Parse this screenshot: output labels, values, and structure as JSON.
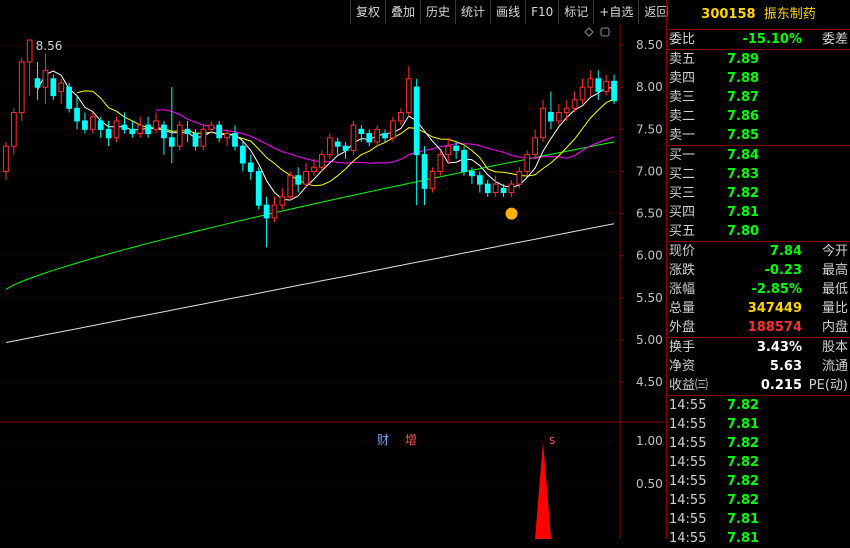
{
  "toolbar": [
    "复权",
    "叠加",
    "历史",
    "统计",
    "画线",
    "F10",
    "标记",
    "+自选",
    "返回"
  ],
  "stock": {
    "code": "300158",
    "name": "振东制药"
  },
  "weibi": {
    "label": "委比",
    "value": "-15.10%",
    "right": "委差"
  },
  "asks": [
    {
      "label": "卖五",
      "price": "7.89"
    },
    {
      "label": "卖四",
      "price": "7.88"
    },
    {
      "label": "卖三",
      "price": "7.87"
    },
    {
      "label": "卖二",
      "price": "7.86"
    },
    {
      "label": "卖一",
      "price": "7.85"
    }
  ],
  "bids": [
    {
      "label": "买一",
      "price": "7.84"
    },
    {
      "label": "买二",
      "price": "7.83"
    },
    {
      "label": "买三",
      "price": "7.82"
    },
    {
      "label": "买四",
      "price": "7.81"
    },
    {
      "label": "买五",
      "price": "7.80"
    }
  ],
  "stats1": [
    {
      "label": "现价",
      "value": "7.84",
      "right": "今开",
      "cls": "green"
    },
    {
      "label": "涨跌",
      "value": "-0.23",
      "right": "最高",
      "cls": "green"
    },
    {
      "label": "涨幅",
      "value": "-2.85%",
      "right": "最低",
      "cls": "green"
    },
    {
      "label": "总量",
      "value": "347449",
      "right": "量比",
      "cls": "yel"
    },
    {
      "label": "外盘",
      "value": "188574",
      "right": "内盘",
      "cls": "red"
    }
  ],
  "stats2": [
    {
      "label": "换手",
      "value": "3.43%",
      "right": "股本",
      "cls": "white"
    },
    {
      "label": "净资",
      "value": "5.63",
      "right": "流通",
      "cls": "white"
    },
    {
      "label": "收益㈢",
      "value": "0.215",
      "right": "PE(动)",
      "cls": "white"
    }
  ],
  "ticks": [
    {
      "time": "14:55",
      "price": "7.82"
    },
    {
      "time": "14:55",
      "price": "7.81"
    },
    {
      "time": "14:55",
      "price": "7.82"
    },
    {
      "time": "14:55",
      "price": "7.82"
    },
    {
      "time": "14:55",
      "price": "7.82"
    },
    {
      "time": "14:55",
      "price": "7.82"
    },
    {
      "time": "14:55",
      "price": "7.81"
    },
    {
      "time": "14:55",
      "price": "7.81"
    }
  ],
  "chart": {
    "price_axis": [
      "8.50",
      "8.00",
      "7.50",
      "7.00",
      "6.50",
      "6.00",
      "5.50",
      "5.00",
      "4.50"
    ],
    "sub_axis": [
      "1.00",
      "0.50"
    ],
    "high_label": "8.56",
    "markers": {
      "cai": "财",
      "zeng": "增",
      "s": "s"
    }
  },
  "chart_data": {
    "type": "candlestick",
    "price_range": [
      4.3,
      8.75
    ],
    "candles": [
      [
        7.0,
        7.3,
        6.9,
        7.35
      ],
      [
        7.3,
        7.7,
        7.2,
        7.75
      ],
      [
        7.7,
        8.3,
        7.6,
        8.35
      ],
      [
        8.3,
        8.56,
        7.9,
        8.56
      ],
      [
        8.1,
        8.0,
        7.85,
        8.3
      ],
      [
        8.0,
        8.2,
        7.8,
        8.4
      ],
      [
        8.1,
        7.9,
        7.85,
        8.15
      ],
      [
        7.95,
        8.05,
        7.8,
        8.1
      ],
      [
        8.0,
        7.75,
        7.7,
        8.05
      ],
      [
        7.75,
        7.6,
        7.5,
        7.9
      ],
      [
        7.6,
        7.5,
        7.45,
        7.7
      ],
      [
        7.5,
        7.65,
        7.45,
        7.7
      ],
      [
        7.6,
        7.5,
        7.4,
        7.65
      ],
      [
        7.5,
        7.4,
        7.3,
        7.6
      ],
      [
        7.4,
        7.6,
        7.35,
        7.65
      ],
      [
        7.55,
        7.5,
        7.45,
        7.7
      ],
      [
        7.5,
        7.45,
        7.4,
        7.6
      ],
      [
        7.45,
        7.55,
        7.4,
        7.65
      ],
      [
        7.55,
        7.45,
        7.4,
        7.65
      ],
      [
        7.5,
        7.6,
        7.45,
        7.7
      ],
      [
        7.55,
        7.4,
        7.2,
        7.6
      ],
      [
        7.4,
        7.3,
        7.1,
        8.0
      ],
      [
        7.3,
        7.55,
        7.25,
        7.6
      ],
      [
        7.5,
        7.45,
        7.35,
        7.6
      ],
      [
        7.45,
        7.3,
        7.25,
        7.5
      ],
      [
        7.3,
        7.5,
        7.25,
        7.55
      ],
      [
        7.5,
        7.55,
        7.45,
        7.6
      ],
      [
        7.55,
        7.4,
        7.35,
        7.6
      ],
      [
        7.4,
        7.45,
        7.3,
        7.5
      ],
      [
        7.45,
        7.3,
        7.25,
        7.55
      ],
      [
        7.3,
        7.1,
        7.0,
        7.35
      ],
      [
        7.1,
        7.0,
        6.9,
        7.2
      ],
      [
        7.0,
        6.6,
        6.55,
        7.05
      ],
      [
        6.6,
        6.45,
        6.1,
        6.7
      ],
      [
        6.45,
        6.6,
        6.4,
        6.7
      ],
      [
        6.6,
        6.7,
        6.55,
        6.8
      ],
      [
        6.7,
        6.95,
        6.65,
        7.0
      ],
      [
        6.95,
        6.85,
        6.75,
        7.05
      ],
      [
        6.85,
        7.0,
        6.8,
        7.1
      ],
      [
        7.0,
        7.05,
        6.95,
        7.15
      ],
      [
        7.05,
        7.2,
        7.0,
        7.25
      ],
      [
        7.2,
        7.4,
        7.15,
        7.45
      ],
      [
        7.35,
        7.3,
        7.2,
        7.4
      ],
      [
        7.3,
        7.25,
        7.15,
        7.35
      ],
      [
        7.25,
        7.55,
        7.2,
        7.6
      ],
      [
        7.5,
        7.45,
        7.35,
        7.55
      ],
      [
        7.45,
        7.35,
        7.3,
        7.5
      ],
      [
        7.35,
        7.5,
        7.3,
        7.55
      ],
      [
        7.45,
        7.4,
        7.35,
        7.5
      ],
      [
        7.4,
        7.6,
        7.35,
        7.65
      ],
      [
        7.6,
        7.7,
        7.55,
        7.75
      ],
      [
        7.7,
        8.1,
        7.65,
        8.25
      ],
      [
        8.0,
        7.2,
        6.6,
        8.1
      ],
      [
        7.2,
        6.8,
        6.6,
        7.3
      ],
      [
        6.8,
        7.0,
        6.75,
        7.05
      ],
      [
        7.0,
        7.2,
        6.95,
        7.25
      ],
      [
        7.2,
        7.3,
        7.1,
        7.4
      ],
      [
        7.3,
        7.25,
        7.15,
        7.35
      ],
      [
        7.25,
        7.0,
        6.95,
        7.3
      ],
      [
        7.0,
        6.95,
        6.85,
        7.05
      ],
      [
        6.95,
        6.85,
        6.75,
        7.0
      ],
      [
        6.85,
        6.75,
        6.7,
        6.9
      ],
      [
        6.75,
        6.85,
        6.7,
        6.95
      ],
      [
        6.8,
        6.75,
        6.7,
        6.85
      ],
      [
        6.75,
        6.85,
        6.7,
        6.9
      ],
      [
        6.85,
        7.0,
        6.8,
        7.05
      ],
      [
        7.0,
        7.2,
        6.95,
        7.25
      ],
      [
        7.2,
        7.4,
        7.15,
        7.5
      ],
      [
        7.4,
        7.75,
        7.35,
        7.85
      ],
      [
        7.7,
        7.6,
        7.5,
        7.95
      ],
      [
        7.6,
        7.7,
        7.55,
        7.8
      ],
      [
        7.7,
        7.75,
        7.6,
        7.85
      ],
      [
        7.75,
        7.85,
        7.7,
        7.95
      ],
      [
        7.85,
        8.0,
        7.8,
        8.1
      ],
      [
        8.0,
        8.1,
        7.9,
        8.2
      ],
      [
        8.1,
        7.95,
        7.85,
        8.2
      ],
      [
        7.95,
        8.07,
        7.9,
        8.15
      ],
      [
        8.07,
        7.84,
        7.8,
        8.15
      ]
    ],
    "ma_colors": {
      "ma5": "#ffffff",
      "ma10": "#ffff00",
      "ma20": "#ff00ff",
      "ma60": "#00ff00",
      "ma250": "#e0e0e0"
    },
    "sub_value_peak": 1.0
  },
  "colors": {
    "up": "#ff3030",
    "down": "#00ffff",
    "grid": "#8a0000"
  }
}
